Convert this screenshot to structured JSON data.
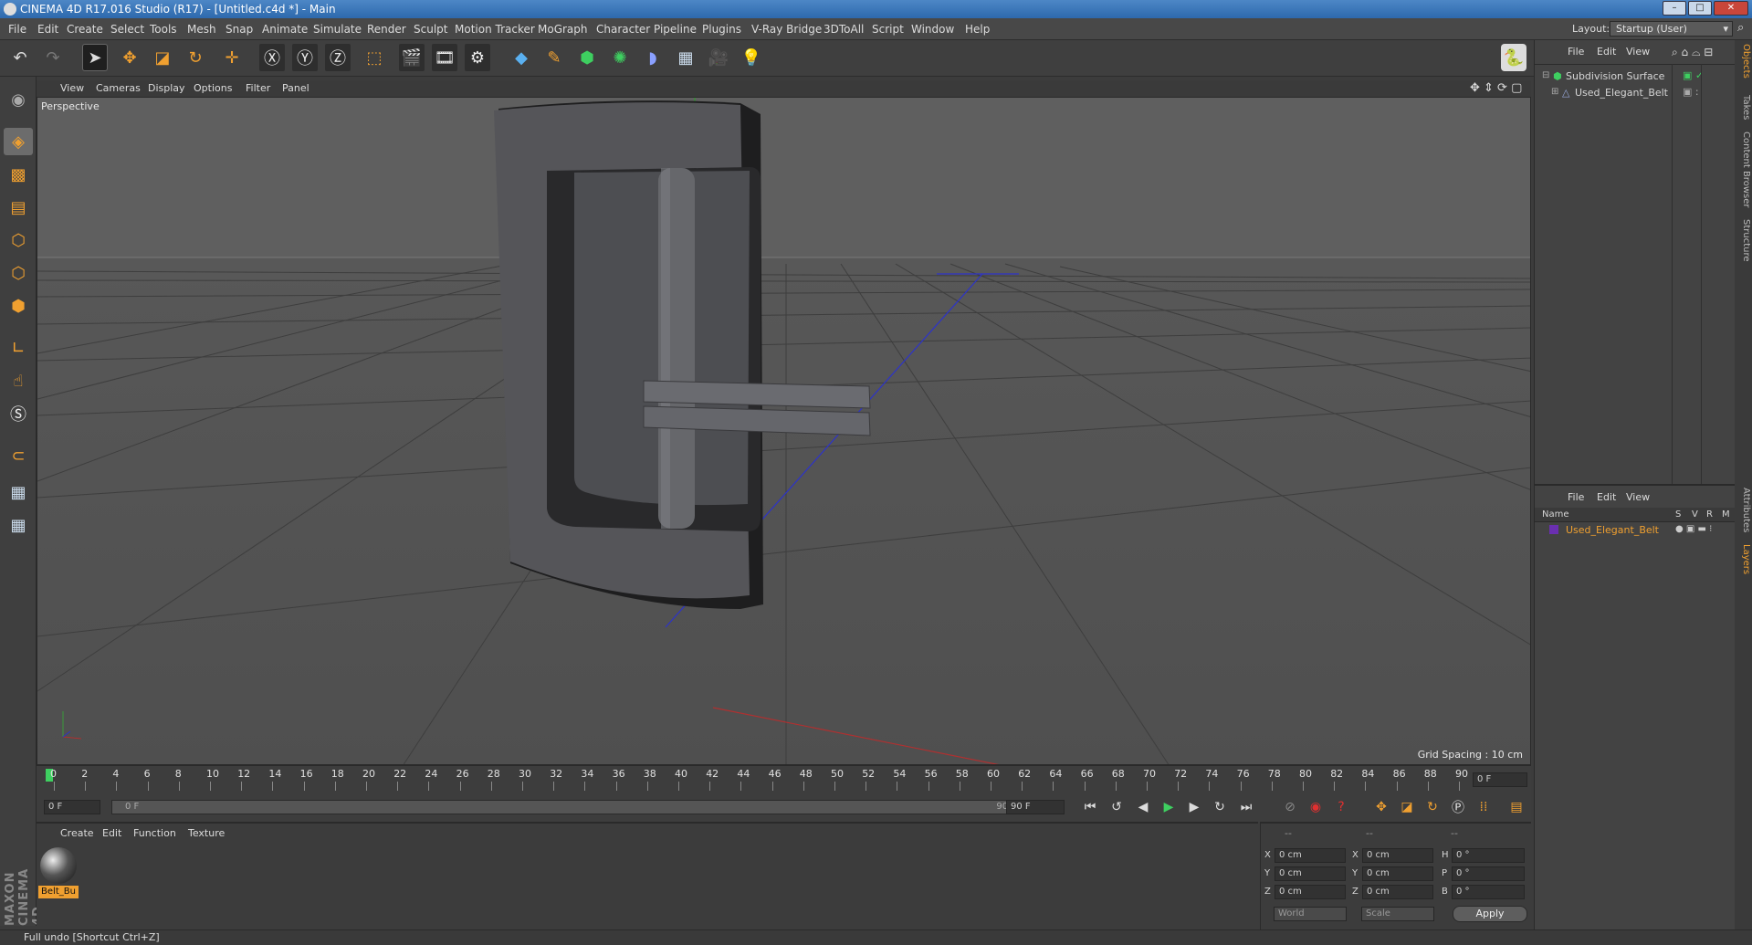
{
  "app": {
    "title": "CINEMA 4D R17.016 Studio (R17) - [Untitled.c4d *] - Main",
    "window_buttons": [
      "–",
      "□",
      "✕"
    ]
  },
  "menu": {
    "items": [
      "File",
      "Edit",
      "Create",
      "Select",
      "Tools",
      "Mesh",
      "Snap",
      "Animate",
      "Simulate",
      "Render",
      "Sculpt",
      "Motion Tracker",
      "MoGraph",
      "Character",
      "Pipeline",
      "Plugins",
      "V-Ray Bridge",
      "3DToAll",
      "Script",
      "Window",
      "Help"
    ],
    "layout_label": "Layout:",
    "layout_value": "Startup (User)"
  },
  "viewport": {
    "menu": [
      "View",
      "Cameras",
      "Display",
      "Options",
      "Filter",
      "Panel"
    ],
    "label": "Perspective",
    "grid_spacing": "Grid Spacing : 10 cm"
  },
  "object_manager": {
    "menu": [
      "File",
      "Edit",
      "View"
    ],
    "objects": [
      {
        "name": "Subdivision Surface",
        "color": "#d6d6d6"
      },
      {
        "name": "Used_Elegant_Belt",
        "color": "#d6d6d6"
      }
    ]
  },
  "layer_manager": {
    "menu": [
      "File",
      "Edit",
      "View"
    ],
    "columns": [
      "Name",
      "S",
      "V",
      "R",
      "M"
    ],
    "rows": [
      {
        "name": "Used_Elegant_Belt",
        "color": "#f0a030"
      }
    ]
  },
  "side_tabs": [
    "Objects",
    "Takes",
    "Content Browser",
    "Structure",
    "Attributes",
    "Layers"
  ],
  "timeline": {
    "ticks": [
      "0",
      "2",
      "4",
      "6",
      "8",
      "10",
      "12",
      "14",
      "16",
      "18",
      "20",
      "22",
      "24",
      "26",
      "28",
      "30",
      "32",
      "34",
      "36",
      "38",
      "40",
      "42",
      "44",
      "46",
      "48",
      "50",
      "52",
      "54",
      "56",
      "58",
      "60",
      "62",
      "64",
      "66",
      "68",
      "70",
      "72",
      "74",
      "76",
      "78",
      "80",
      "82",
      "84",
      "86",
      "88",
      "90"
    ],
    "current_frame": "0 F",
    "start": "0 F",
    "range_start": "0 F",
    "range_end": "90 F",
    "end": "90 F"
  },
  "material_manager": {
    "menu": [
      "Create",
      "Edit",
      "Function",
      "Texture"
    ],
    "material_name": "Belt_Bu"
  },
  "coordinates": {
    "headers": [
      "--",
      "--",
      "--"
    ],
    "rows": [
      {
        "a": "X",
        "av": "0 cm",
        "b": "X",
        "bv": "0 cm",
        "c": "H",
        "cv": "0 °"
      },
      {
        "a": "Y",
        "av": "0 cm",
        "b": "Y",
        "bv": "0 cm",
        "c": "P",
        "cv": "0 °"
      },
      {
        "a": "Z",
        "av": "0 cm",
        "b": "Z",
        "bv": "0 cm",
        "c": "B",
        "cv": "0 °"
      }
    ],
    "mode1": "World",
    "mode2": "Scale",
    "apply": "Apply"
  },
  "brand": "MAXON CINEMA 4D",
  "status": "Full undo [Shortcut Ctrl+Z]"
}
